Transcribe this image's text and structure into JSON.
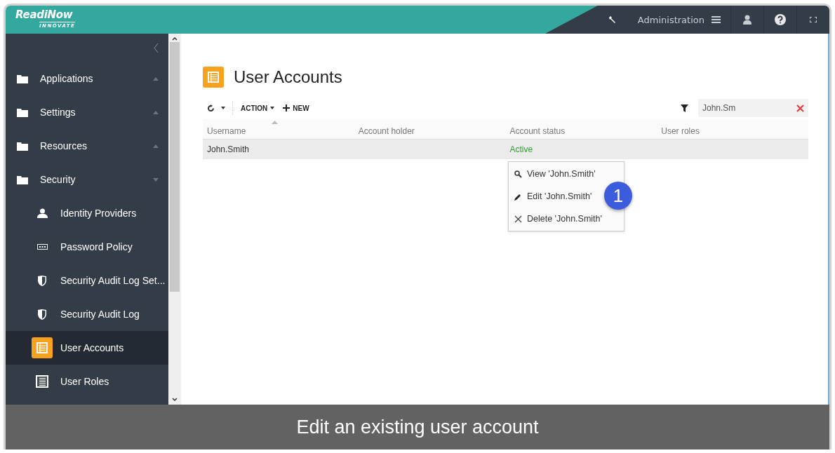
{
  "logo": {
    "name": "ReadiNow",
    "tagline": "INNOVATE"
  },
  "header": {
    "section": "Administration"
  },
  "sidebar": {
    "items": [
      {
        "label": "Applications",
        "kind": "folder",
        "expanded": false,
        "selected": false
      },
      {
        "label": "Settings",
        "kind": "folder",
        "expanded": false,
        "selected": false
      },
      {
        "label": "Resources",
        "kind": "folder",
        "expanded": false,
        "selected": false
      },
      {
        "label": "Security",
        "kind": "folder",
        "expanded": true,
        "selected": false,
        "children": [
          {
            "label": "Identity Providers",
            "kind": "person",
            "selected": false
          },
          {
            "label": "Password Policy",
            "kind": "password",
            "selected": false
          },
          {
            "label": "Security Audit Log Set...",
            "kind": "shield",
            "selected": false
          },
          {
            "label": "Security Audit Log",
            "kind": "shield",
            "selected": false
          },
          {
            "label": "User Accounts",
            "kind": "report",
            "selected": true
          },
          {
            "label": "User Roles",
            "kind": "report",
            "selected": false
          }
        ]
      }
    ]
  },
  "page": {
    "title": "User Accounts",
    "toolbar": {
      "action": "ACTION",
      "new": "NEW"
    },
    "filter": {
      "value": "John.Sm"
    },
    "table": {
      "columns": [
        "Username",
        "Account holder",
        "Account status",
        "User roles"
      ],
      "rows": [
        {
          "cells": [
            "John.Smith",
            "",
            "Active",
            ""
          ],
          "selected": true
        }
      ]
    },
    "context_menu": [
      {
        "kind": "view",
        "label": "View 'John.Smith'"
      },
      {
        "kind": "edit",
        "label": "Edit 'John.Smith'"
      },
      {
        "kind": "delete",
        "label": "Delete 'John.Smith'"
      }
    ],
    "step_badge": "1"
  },
  "caption": "Edit an existing user account"
}
